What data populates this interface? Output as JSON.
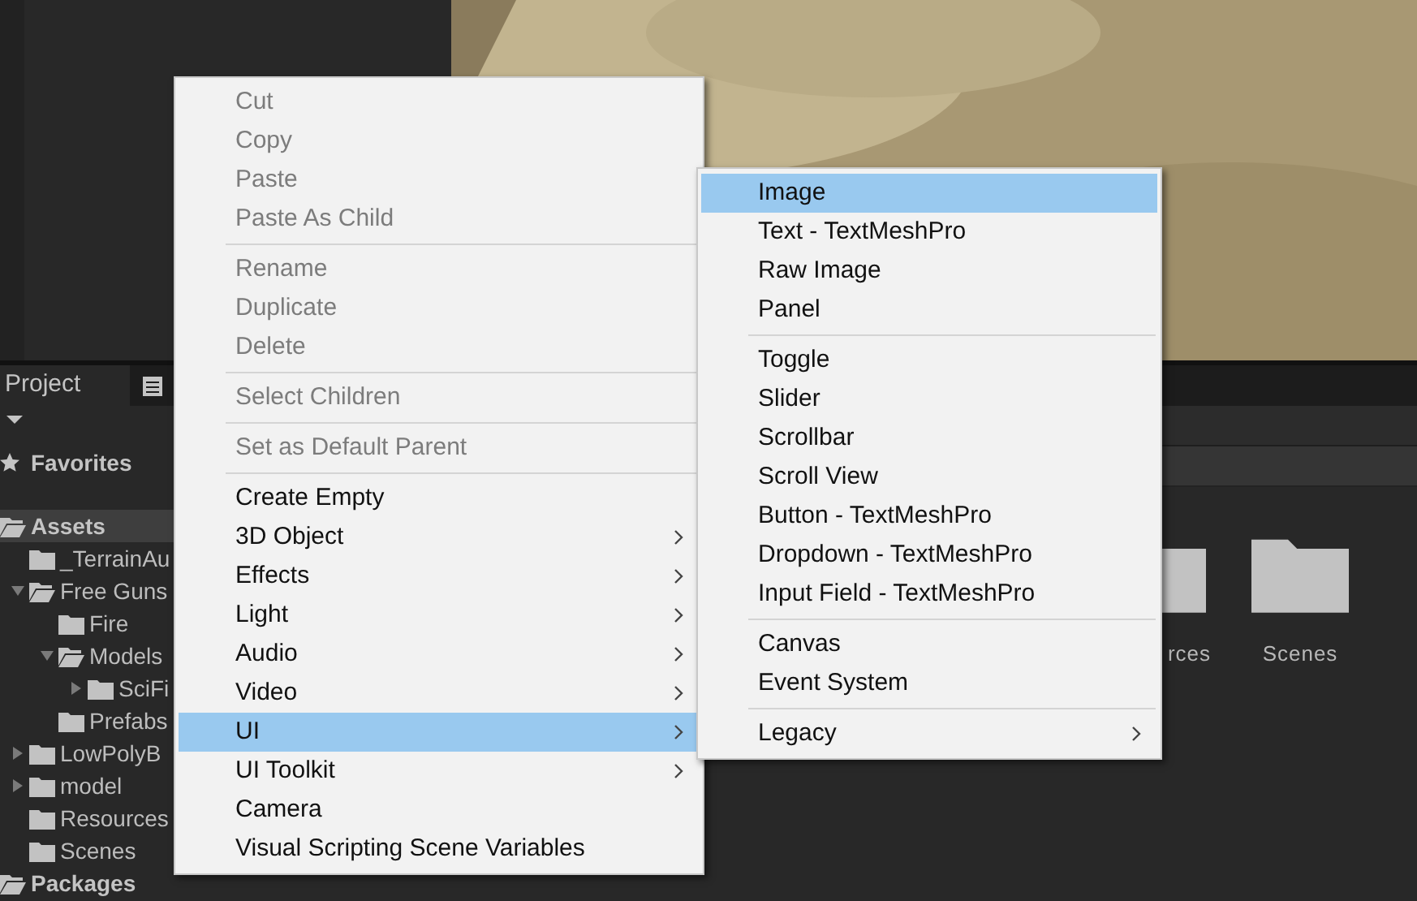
{
  "project_panel": {
    "tab": "Project",
    "favorites": "Favorites",
    "tree": [
      {
        "label": "Assets",
        "expanded": true,
        "selected": true,
        "children": [
          {
            "label": "_TerrainAu"
          },
          {
            "label": "Free Guns",
            "expanded": true,
            "children": [
              {
                "label": "Fire"
              },
              {
                "label": "Models",
                "expanded": true,
                "children": [
                  {
                    "label": "SciFi",
                    "expanded": false
                  }
                ]
              },
              {
                "label": "Prefabs"
              }
            ]
          },
          {
            "label": "LowPolyB",
            "expanded": false
          },
          {
            "label": "model",
            "expanded": false
          },
          {
            "label": "Resources"
          },
          {
            "label": "Scenes"
          }
        ]
      },
      {
        "label": "Packages",
        "expanded": true,
        "selected": false
      }
    ],
    "folders": [
      {
        "label": "rces"
      },
      {
        "label": "Scenes"
      }
    ]
  },
  "context_menu": {
    "items": [
      {
        "kind": "item",
        "label": "Cut",
        "disabled": true,
        "submenu": false,
        "selected": false
      },
      {
        "kind": "item",
        "label": "Copy",
        "disabled": true,
        "submenu": false,
        "selected": false
      },
      {
        "kind": "item",
        "label": "Paste",
        "disabled": true,
        "submenu": false,
        "selected": false
      },
      {
        "kind": "item",
        "label": "Paste As Child",
        "disabled": true,
        "submenu": false,
        "selected": false
      },
      {
        "kind": "separator"
      },
      {
        "kind": "item",
        "label": "Rename",
        "disabled": true,
        "submenu": false,
        "selected": false
      },
      {
        "kind": "item",
        "label": "Duplicate",
        "disabled": true,
        "submenu": false,
        "selected": false
      },
      {
        "kind": "item",
        "label": "Delete",
        "disabled": true,
        "submenu": false,
        "selected": false
      },
      {
        "kind": "separator"
      },
      {
        "kind": "item",
        "label": "Select Children",
        "disabled": true,
        "submenu": false,
        "selected": false
      },
      {
        "kind": "separator"
      },
      {
        "kind": "item",
        "label": "Set as Default Parent",
        "disabled": true,
        "submenu": false,
        "selected": false
      },
      {
        "kind": "separator"
      },
      {
        "kind": "item",
        "label": "Create Empty",
        "disabled": false,
        "submenu": false,
        "selected": false
      },
      {
        "kind": "item",
        "label": "3D Object",
        "disabled": false,
        "submenu": true,
        "selected": false
      },
      {
        "kind": "item",
        "label": "Effects",
        "disabled": false,
        "submenu": true,
        "selected": false
      },
      {
        "kind": "item",
        "label": "Light",
        "disabled": false,
        "submenu": true,
        "selected": false
      },
      {
        "kind": "item",
        "label": "Audio",
        "disabled": false,
        "submenu": true,
        "selected": false
      },
      {
        "kind": "item",
        "label": "Video",
        "disabled": false,
        "submenu": true,
        "selected": false
      },
      {
        "kind": "item",
        "label": "UI",
        "disabled": false,
        "submenu": true,
        "selected": true
      },
      {
        "kind": "item",
        "label": "UI Toolkit",
        "disabled": false,
        "submenu": true,
        "selected": false
      },
      {
        "kind": "item",
        "label": "Camera",
        "disabled": false,
        "submenu": false,
        "selected": false
      },
      {
        "kind": "item",
        "label": "Visual Scripting Scene Variables",
        "disabled": false,
        "submenu": false,
        "selected": false
      }
    ]
  },
  "submenu": {
    "items": [
      {
        "kind": "item",
        "label": "Image",
        "disabled": false,
        "submenu": false,
        "selected": true
      },
      {
        "kind": "item",
        "label": "Text - TextMeshPro",
        "disabled": false,
        "submenu": false,
        "selected": false
      },
      {
        "kind": "item",
        "label": "Raw Image",
        "disabled": false,
        "submenu": false,
        "selected": false
      },
      {
        "kind": "item",
        "label": "Panel",
        "disabled": false,
        "submenu": false,
        "selected": false
      },
      {
        "kind": "separator"
      },
      {
        "kind": "item",
        "label": "Toggle",
        "disabled": false,
        "submenu": false,
        "selected": false
      },
      {
        "kind": "item",
        "label": "Slider",
        "disabled": false,
        "submenu": false,
        "selected": false
      },
      {
        "kind": "item",
        "label": "Scrollbar",
        "disabled": false,
        "submenu": false,
        "selected": false
      },
      {
        "kind": "item",
        "label": "Scroll View",
        "disabled": false,
        "submenu": false,
        "selected": false
      },
      {
        "kind": "item",
        "label": "Button - TextMeshPro",
        "disabled": false,
        "submenu": false,
        "selected": false
      },
      {
        "kind": "item",
        "label": "Dropdown - TextMeshPro",
        "disabled": false,
        "submenu": false,
        "selected": false
      },
      {
        "kind": "item",
        "label": "Input Field - TextMeshPro",
        "disabled": false,
        "submenu": false,
        "selected": false
      },
      {
        "kind": "separator"
      },
      {
        "kind": "item",
        "label": "Canvas",
        "disabled": false,
        "submenu": false,
        "selected": false
      },
      {
        "kind": "item",
        "label": "Event System",
        "disabled": false,
        "submenu": false,
        "selected": false
      },
      {
        "kind": "separator"
      },
      {
        "kind": "item",
        "label": "Legacy",
        "disabled": false,
        "submenu": true,
        "selected": false
      }
    ]
  }
}
